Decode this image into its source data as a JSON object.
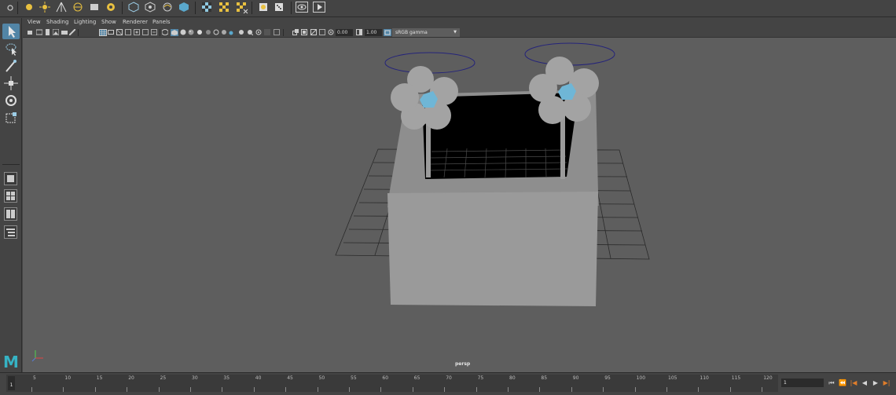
{
  "panel_menu": {
    "view": "View",
    "shading": "Shading",
    "lighting": "Lighting",
    "show": "Show",
    "renderer": "Renderer",
    "panels": "Panels"
  },
  "panel_toolbar": {
    "exposure_value": "0.00",
    "gamma_value": "1.00",
    "color_space": "sRGB gamma"
  },
  "viewport": {
    "camera_label": "persp"
  },
  "timeline": {
    "tick_labels": [
      "5",
      "10",
      "15",
      "20",
      "25",
      "30",
      "35",
      "40",
      "45",
      "50",
      "55",
      "60",
      "65",
      "70",
      "75",
      "80",
      "85",
      "90",
      "95",
      "100",
      "105",
      "110",
      "115",
      "120"
    ],
    "current_frame": "1",
    "frame_field": "1"
  },
  "logo": "M",
  "colors": {
    "accent": "#5285a6",
    "viewport_bg": "#5e5e5e",
    "ui_bg": "#444444",
    "flower_center": "#6fb6d6",
    "halo": "#25247a"
  }
}
